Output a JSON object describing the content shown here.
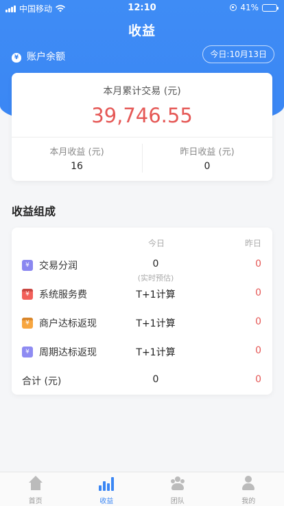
{
  "status_bar": {
    "carrier": "中国移动",
    "time": "12:10",
    "battery": "41%",
    "battery_level": 0.41
  },
  "header": {
    "title": "收益",
    "balance_label": "账户余额",
    "date": "今日:10月13日"
  },
  "summary": {
    "monthly_trade_label": "本月累计交易 (元)",
    "monthly_trade_value": "39,746.55",
    "monthly_income_label": "本月收益 (元)",
    "monthly_income_value": "16",
    "yesterday_income_label": "昨日收益 (元)",
    "yesterday_income_value": "0"
  },
  "composition": {
    "title": "收益组成",
    "col_today": "今日",
    "col_yesterday": "昨日",
    "rows": [
      {
        "name": "交易分润",
        "today": "0",
        "today_sub": "(实时预估)",
        "yesterday": "0",
        "icon": "ticket-icon"
      },
      {
        "name": "系统服务费",
        "today": "T+1计算",
        "yesterday": "0",
        "icon": "wallet-icon"
      },
      {
        "name": "商户达标返现",
        "today": "T+1计算",
        "yesterday": "0",
        "icon": "cashback-icon"
      },
      {
        "name": "周期达标返现",
        "today": "T+1计算",
        "yesterday": "0",
        "icon": "coin-icon"
      }
    ],
    "total_label": "合计 (元)",
    "total_today": "0",
    "total_yesterday": "0"
  },
  "tabbar": {
    "items": [
      {
        "label": "首页",
        "icon": "home-icon"
      },
      {
        "label": "收益",
        "icon": "bar-chart-icon",
        "active": true
      },
      {
        "label": "团队",
        "icon": "team-icon"
      },
      {
        "label": "我的",
        "icon": "user-icon"
      }
    ]
  },
  "colors": {
    "primary": "#3a86f4",
    "accent_red": "#e55856"
  }
}
